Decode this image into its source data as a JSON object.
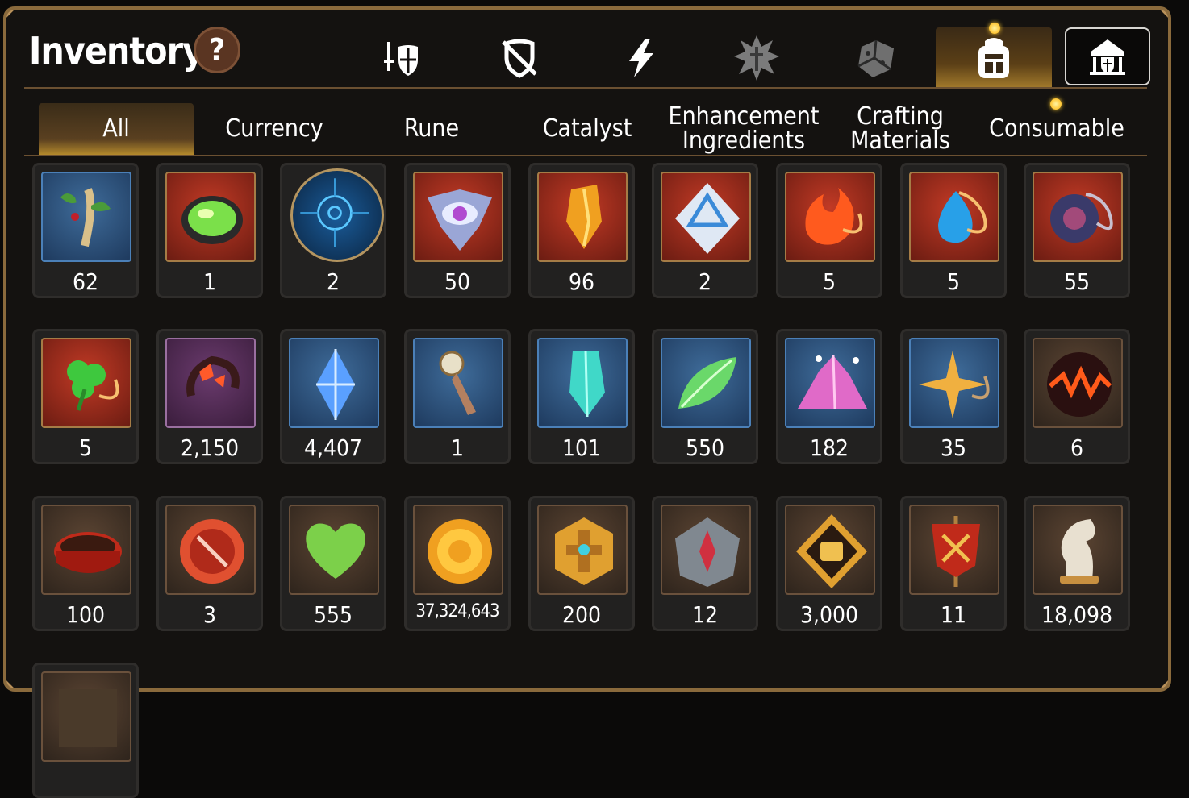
{
  "header": {
    "title": "Inventory",
    "help_label": "?"
  },
  "top_icons": [
    "guild-knight-icon",
    "crossed-shield-icon",
    "lightning-icon",
    "rune-splash-icon",
    "dice-icon",
    "backpack-icon",
    "castle-icon"
  ],
  "tabs": [
    {
      "label": "All"
    },
    {
      "label": "Currency"
    },
    {
      "label": "Rune"
    },
    {
      "label": "Catalyst"
    },
    {
      "label": "Enhancement Ingredients"
    },
    {
      "label": "Crafting Materials"
    },
    {
      "label": "Consumable"
    }
  ],
  "items": [
    {
      "count": "62",
      "icon": "ginseng-root-icon",
      "bg": "blue"
    },
    {
      "count": "1",
      "icon": "green-gem-icon",
      "bg": "red"
    },
    {
      "count": "2",
      "icon": "blue-rune-orb-icon",
      "bg": "round"
    },
    {
      "count": "50",
      "icon": "eye-crystal-icon",
      "bg": "red"
    },
    {
      "count": "96",
      "icon": "amber-crystal-icon",
      "bg": "red"
    },
    {
      "count": "2",
      "icon": "blue-diamond-rune-icon",
      "bg": "red"
    },
    {
      "count": "5",
      "icon": "fire-pendant-icon",
      "bg": "red"
    },
    {
      "count": "5",
      "icon": "water-pendant-icon",
      "bg": "red"
    },
    {
      "count": "55",
      "icon": "dark-ring-pendant-icon",
      "bg": "red"
    },
    {
      "count": "5",
      "icon": "clover-pendant-icon",
      "bg": "red"
    },
    {
      "count": "2,150",
      "icon": "flame-swirl-icon",
      "bg": "purple"
    },
    {
      "count": "4,407",
      "icon": "blue-crystal-icon",
      "bg": "blue"
    },
    {
      "count": "1",
      "icon": "key-pendulum-icon",
      "bg": "blue"
    },
    {
      "count": "101",
      "icon": "teal-crystal-icon",
      "bg": "blue"
    },
    {
      "count": "550",
      "icon": "green-leaf-icon",
      "bg": "blue"
    },
    {
      "count": "182",
      "icon": "pink-ore-icon",
      "bg": "blue"
    },
    {
      "count": "35",
      "icon": "star-pendant-icon",
      "bg": "blue"
    },
    {
      "count": "6",
      "icon": "lava-orb-icon",
      "bg": "brown"
    },
    {
      "count": "100",
      "icon": "red-bracelet-icon",
      "bg": "brown"
    },
    {
      "count": "3",
      "icon": "red-seal-icon",
      "bg": "brown"
    },
    {
      "count": "555",
      "icon": "green-heart-icon",
      "bg": "brown"
    },
    {
      "count": "37,324,643",
      "icon": "gold-coin-icon",
      "bg": "brown"
    },
    {
      "count": "200",
      "icon": "gold-medallion-icon",
      "bg": "brown"
    },
    {
      "count": "12",
      "icon": "stone-compass-icon",
      "bg": "brown"
    },
    {
      "count": "3,000",
      "icon": "fist-badge-icon",
      "bg": "brown"
    },
    {
      "count": "11",
      "icon": "war-banner-icon",
      "bg": "brown"
    },
    {
      "count": "18,098",
      "icon": "horse-chess-icon",
      "bg": "brown"
    },
    {
      "count": "",
      "icon": "partial-item-icon",
      "bg": "brown"
    }
  ],
  "colors": {
    "accent": "#b48a2c",
    "frame": "#8a6a3c",
    "badge": "#ffb000"
  }
}
